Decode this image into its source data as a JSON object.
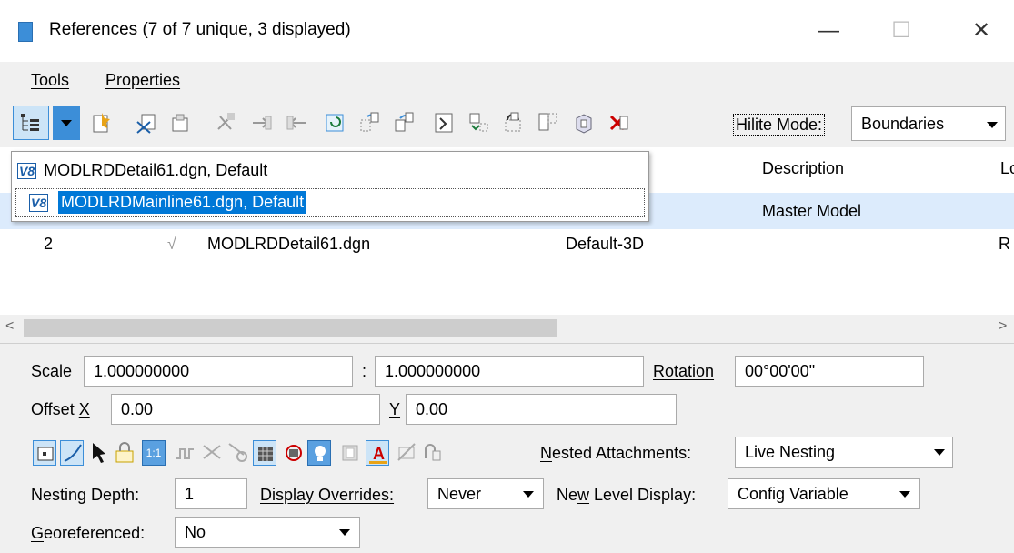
{
  "window": {
    "title": "References (7 of 7 unique, 3 displayed)",
    "controls": [
      "—",
      "☐",
      "✕"
    ]
  },
  "menu": {
    "tools": "Tools",
    "properties": "Properties"
  },
  "toolbar": {
    "hilite_label": "Hilite Mode:",
    "hilite_value": "Boundaries",
    "icons": [
      "tree-view-icon",
      "attach-icon",
      "detach-icon",
      "reload-icon",
      "exchange-icon",
      "move-icon",
      "copy-icon",
      "rotate-icon",
      "scale-icon",
      "mirror-horizontal-icon",
      "mirror-vertical-icon",
      "clip-boundary-icon",
      "clip-mask-icon",
      "clip-delete-icon",
      "hole-icon",
      "model-3d-icon",
      "delete-icon"
    ]
  },
  "dropdown": {
    "badge": "V8",
    "items": [
      "MODLRDDetail61.dgn, Default",
      "MODLRDMainline61.dgn, Default"
    ]
  },
  "table": {
    "headers": {
      "description": "Description",
      "logical": "Lo"
    },
    "rows": [
      {
        "slot": "",
        "check": "",
        "file": "",
        "model": "",
        "description": "Master Model",
        "logical": ""
      },
      {
        "slot": "2",
        "check": "√",
        "file": "MODLRDDetail61.dgn",
        "model": "Default-3D",
        "description": "",
        "logical": "R"
      }
    ]
  },
  "scroll": {
    "left": "<",
    "right": ">"
  },
  "props": {
    "scale_label": "Scale",
    "scale_a": "1.000000000",
    "scale_sep": ":",
    "scale_b": "1.000000000",
    "rotation_label": "Rotation",
    "rotation_value": "00°00'00\"",
    "offset_label": "Offset",
    "offset_x_label": "X",
    "offset_x": "0.00",
    "offset_y_label": "Y",
    "offset_y": "0.00",
    "nested_label_pre": "N",
    "nested_label_post": "ested Attachments:",
    "nested_value": "Live Nesting",
    "depth_label": "Nesting Depth:",
    "depth_value": "1",
    "overrides_label": "Display Overrides:",
    "overrides_value": "Never",
    "newlevel_label_pre": "Ne",
    "newlevel_label_u": "w",
    "newlevel_label_post": " Level Display:",
    "newlevel_value": "Config Variable",
    "geo_label_pre": "G",
    "geo_label_post": "eoreferenced:",
    "geo_value": "No",
    "scale_ratio_icon_text": "1:1"
  },
  "colors": {
    "selection": "#0078d7",
    "row_highlight": "#dcebfc",
    "accent": "#3c8ed8"
  }
}
